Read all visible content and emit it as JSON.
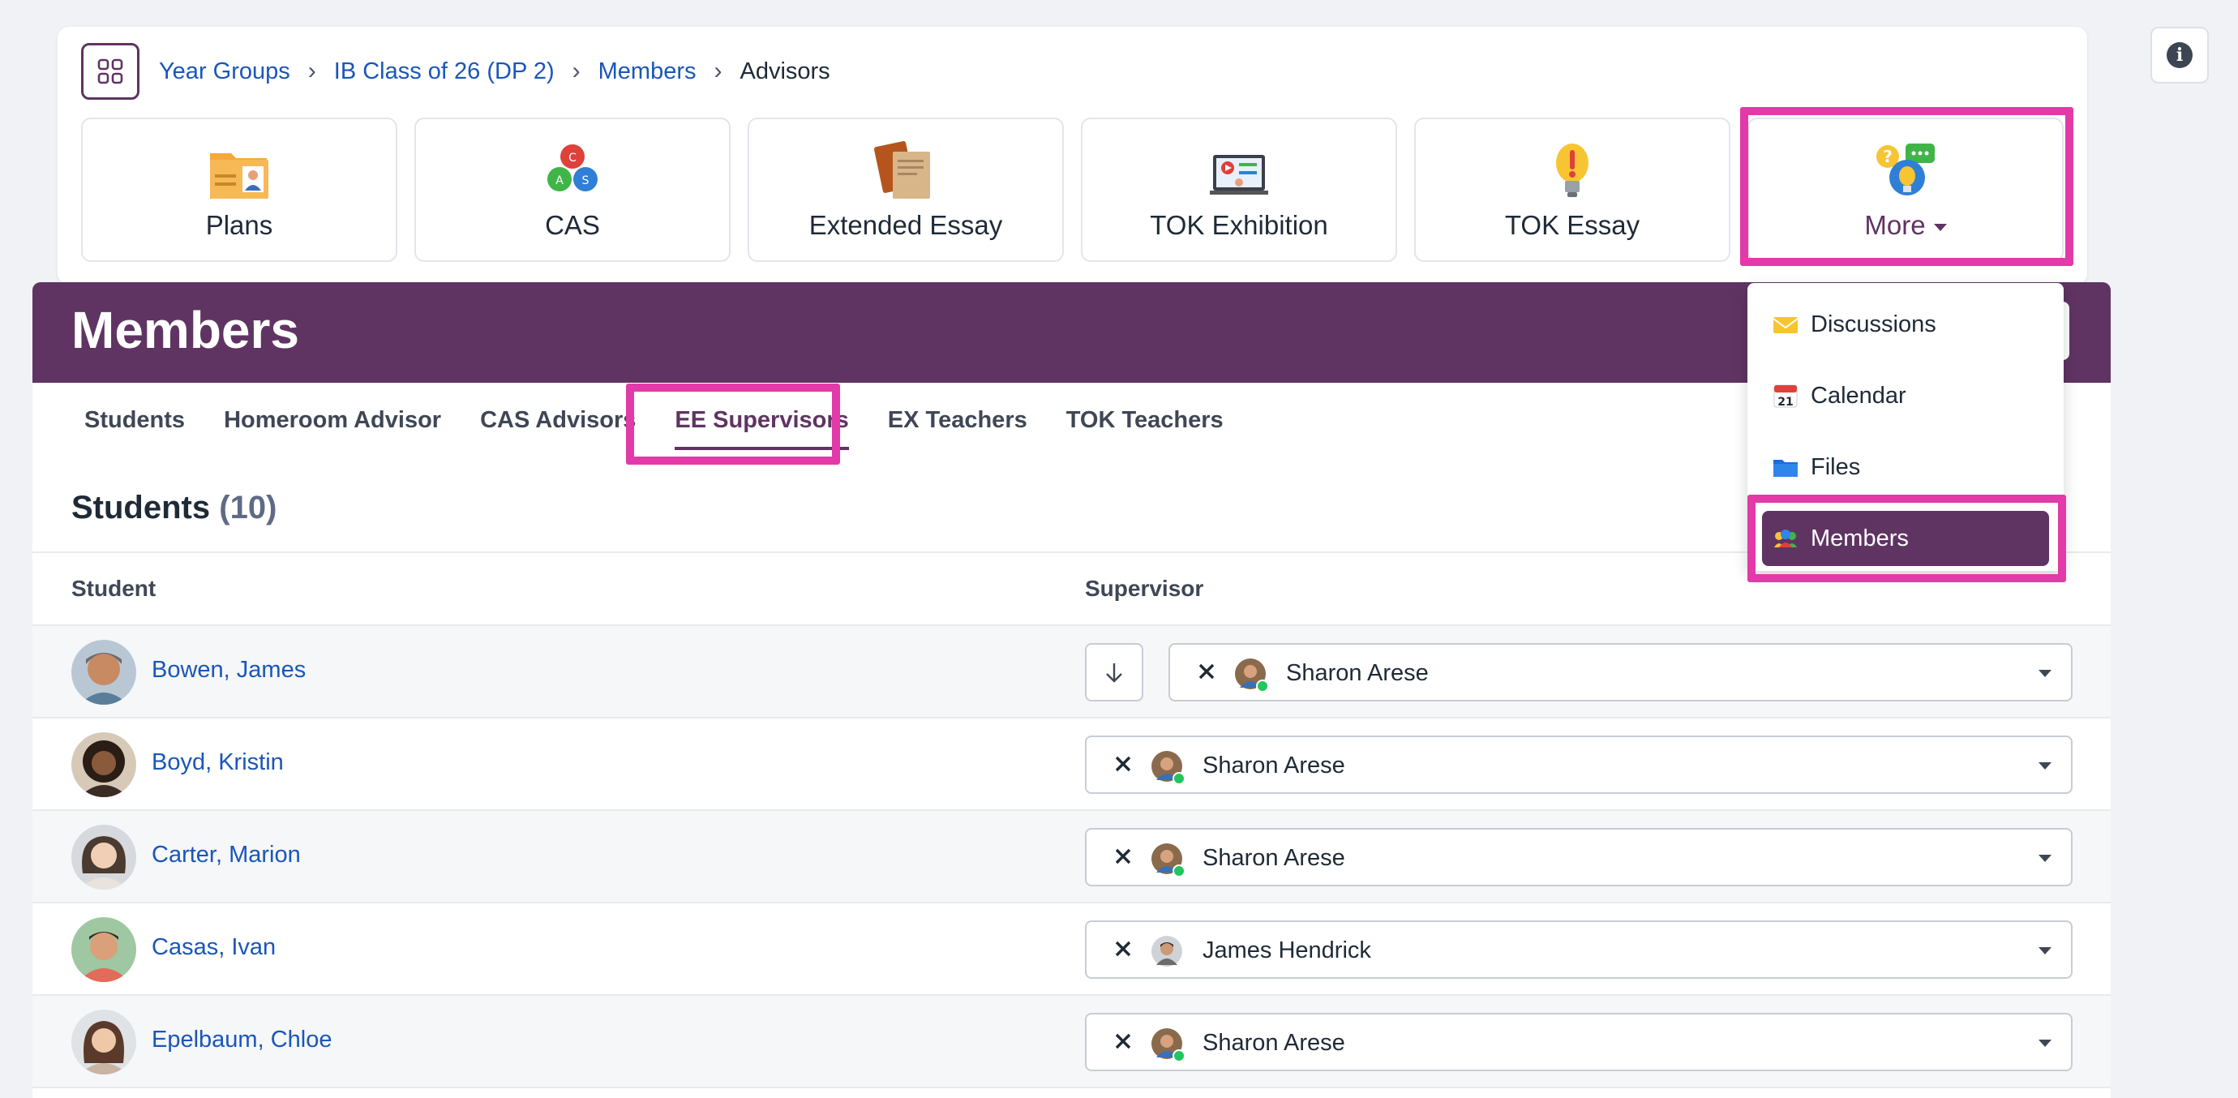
{
  "breadcrumb": {
    "items": [
      "Year Groups",
      "IB Class of 26 (DP 2)",
      "Members"
    ],
    "current": "Advisors"
  },
  "tiles": [
    {
      "label": "Plans",
      "icon": "plans-icon"
    },
    {
      "label": "CAS",
      "icon": "cas-icon"
    },
    {
      "label": "Extended Essay",
      "icon": "extended-essay-icon"
    },
    {
      "label": "TOK Exhibition",
      "icon": "tok-exhibition-icon"
    },
    {
      "label": "TOK Essay",
      "icon": "tok-essay-icon"
    },
    {
      "label": "More",
      "icon": "more-icon"
    }
  ],
  "page_title": "Members",
  "tabs": [
    "Students",
    "Homeroom Advisor",
    "CAS Advisors",
    "EE Supervisors",
    "EX Teachers",
    "TOK Teachers"
  ],
  "active_tab": "EE Supervisors",
  "section": {
    "title": "Students",
    "count": "(10)"
  },
  "table": {
    "headers": {
      "student": "Student",
      "supervisor": "Supervisor"
    },
    "rows": [
      {
        "student": "Bowen, James",
        "supervisor": "Sharon Arese"
      },
      {
        "student": "Boyd, Kristin",
        "supervisor": "Sharon Arese"
      },
      {
        "student": "Carter, Marion",
        "supervisor": "Sharon Arese"
      },
      {
        "student": "Casas, Ivan",
        "supervisor": "James Hendrick"
      },
      {
        "student": "Epelbaum, Chloe",
        "supervisor": "Sharon Arese"
      }
    ]
  },
  "more_menu": {
    "items": [
      {
        "label": "Discussions",
        "icon": "envelope-icon"
      },
      {
        "label": "Calendar",
        "icon": "calendar-icon",
        "icon_text": "21"
      },
      {
        "label": "Files",
        "icon": "folder-icon"
      },
      {
        "label": "Members",
        "icon": "people-icon"
      }
    ],
    "active": "Members"
  },
  "colors": {
    "brand": "#5f3462",
    "highlight": "#e23aa8",
    "link": "#1a56b8",
    "online": "#22c55e"
  }
}
